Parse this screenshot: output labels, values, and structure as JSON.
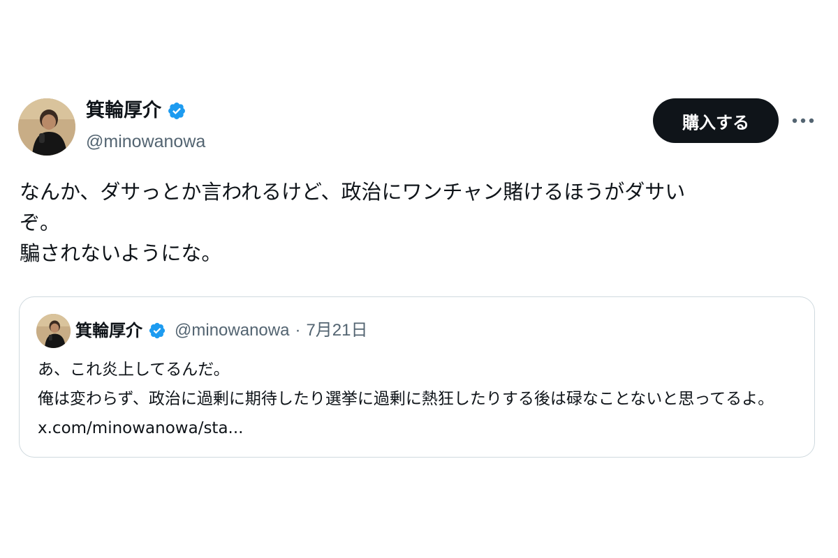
{
  "tweet": {
    "author_name": "箕輪厚介",
    "handle": "@minowanowa",
    "buy_button_label": "購入する",
    "more_icon": "more-horizontal-icon",
    "verified_icon": "verified-badge-icon",
    "text": "なんか、ダサっとか言われるけど、政治にワンチャン賭けるほうがダサい\nぞ。\n騙されないようにな。"
  },
  "quote": {
    "author_name": "箕輪厚介",
    "handle": "@minowanowa",
    "separator": "·",
    "date": "7月21日",
    "text_line1": "あ、これ炎上してるんだ。",
    "text_body": "俺は変わらず、政治に過剰に期待したり選挙に過剰に熱狂したりする後は碌なことないと思ってるよ。",
    "link_text": "x.com/minowanowa/sta..."
  },
  "colors": {
    "text_primary": "#0f1419",
    "text_secondary": "#536471",
    "verified_blue": "#1d9bf0",
    "button_bg": "#0f1419",
    "card_border": "#cfd9de"
  }
}
